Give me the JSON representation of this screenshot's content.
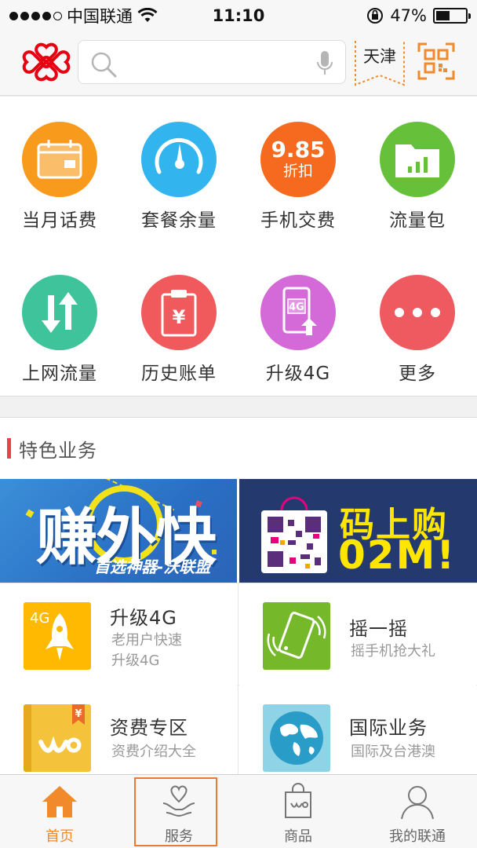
{
  "status_bar": {
    "carrier": "中国联通",
    "time": "11:10",
    "battery": "47%",
    "battery_level": 0.47
  },
  "header": {
    "search_placeholder": "",
    "city": "天津"
  },
  "grid": [
    {
      "label": "当月话费",
      "icon": "calendar-icon",
      "color": "#f89b1c"
    },
    {
      "label": "套餐余量",
      "icon": "gauge-icon",
      "color": "#32b4ee"
    },
    {
      "label": "手机交费",
      "icon": "discount-badge-icon",
      "color": "#f56a1e",
      "badge_top": "9.85",
      "badge_bottom": "折扣"
    },
    {
      "label": "流量包",
      "icon": "folder-chart-icon",
      "color": "#67c03a"
    },
    {
      "label": "上网流量",
      "icon": "updown-arrows-icon",
      "color": "#3ec39a"
    },
    {
      "label": "历史账单",
      "icon": "bill-clipboard-icon",
      "color": "#f15a5c"
    },
    {
      "label": "升级4G",
      "icon": "phone-4g-icon",
      "color": "#d46ad8",
      "badge": "4G"
    },
    {
      "label": "更多",
      "icon": "more-dots-icon",
      "color": "#ee5a5f"
    }
  ],
  "section": {
    "title": "特色业务"
  },
  "banners": {
    "left": {
      "big_text": "赚外快",
      "sub_text": "首选神器-沃联盟"
    },
    "right": {
      "line1": "码上购",
      "line2": "02M!"
    }
  },
  "cards": [
    {
      "title": "升级4G",
      "desc": "老用户快速升级4G",
      "desc_lines": [
        "老用户快速",
        "升级4G"
      ],
      "icon": "rocket-4g-icon",
      "color": "#ffb900",
      "badge": "4G"
    },
    {
      "title": "摇一摇",
      "desc": "摇手机抢大礼",
      "desc_lines": [
        "摇手机抢大礼"
      ],
      "icon": "shake-phone-icon",
      "color": "#75b82a"
    },
    {
      "title": "资费专区",
      "desc": "资费介绍大全",
      "desc_lines": [
        "资费介绍大全"
      ],
      "icon": "price-book-icon",
      "color": "#f5c33b",
      "badge": "¥"
    },
    {
      "title": "国际业务",
      "desc": "国际及台港澳",
      "desc_lines": [
        "国际及台港澳"
      ],
      "icon": "globe-icon",
      "color": "#4fb5d6"
    }
  ],
  "tabs": [
    {
      "label": "首页",
      "icon": "home-icon",
      "active": true
    },
    {
      "label": "服务",
      "icon": "heart-hands-icon",
      "active": false
    },
    {
      "label": "商品",
      "icon": "shopping-bag-icon",
      "active": false
    },
    {
      "label": "我的联通",
      "icon": "user-icon",
      "active": false
    }
  ],
  "colors": {
    "accent": "#f08a2a",
    "brand_red": "#e60012",
    "section_bar": "#e3434b"
  }
}
